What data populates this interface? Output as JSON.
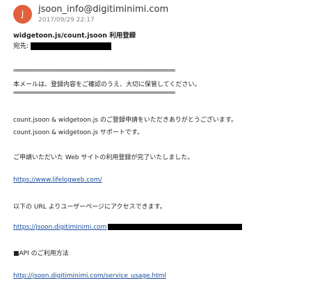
{
  "sender": {
    "avatar_initial": "J",
    "email": "jsoon_info@digitiminimi.com",
    "date": "2017/09/29 22:17"
  },
  "message": {
    "subject": "widgetoon.js/count.jsoon 利用登録",
    "to_label": "宛先:",
    "rule_top": "================================================================",
    "notice": "本メールは、登録内容をご確認のうえ、大切に保管してください。",
    "rule_bottom": "================================================================",
    "thanks": "count.jsoon & widgetoon.js のご登録申請をいただきありがとうございます。",
    "support": "count.jsoon & widgetoon.js サポートです。",
    "complete": "ご申請いただいた Web サイトの利用登録が完了いたしました。",
    "site_link": "https://www.lifelogweb.com/",
    "access_text": "以下の URL よりユーザーページにアクセスできます。",
    "user_link": "https://jsoon.digitiminimi.com",
    "api_heading": "■API のご利用方法",
    "usage_link": "http://jsoon.digitiminimi.com/service_usage.html"
  },
  "colors": {
    "avatar": "#e2603c",
    "link": "#1a4ca0",
    "redaction": "#000000"
  }
}
